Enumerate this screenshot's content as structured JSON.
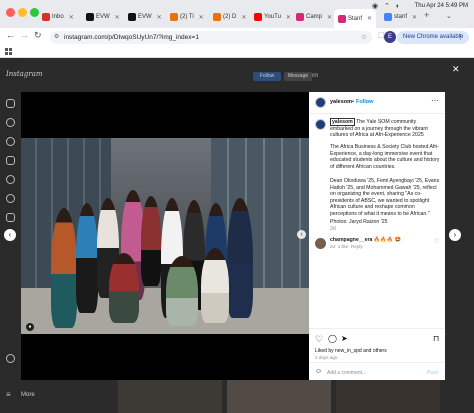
{
  "tabs": [
    {
      "label": "Inbo",
      "color": "#d93025"
    },
    {
      "label": "EVW",
      "color": "#111111"
    },
    {
      "label": "EVW",
      "color": "#111111"
    },
    {
      "label": "(2) Ti",
      "color": "#e8710a"
    },
    {
      "label": "(2) D",
      "color": "#e8710a"
    },
    {
      "label": "YouTu",
      "color": "#ff0000"
    },
    {
      "label": "Camp",
      "color": "#d62976"
    },
    {
      "label": "Stanf",
      "color": "#d62976"
    },
    {
      "label": "stanf",
      "color": "#4285f4"
    }
  ],
  "system": {
    "time": "Thu Apr 24 5:49 PM"
  },
  "address": {
    "url": "instagram.com/p/DIwqoSUyUn7/?img_index=1"
  },
  "chrome_update": {
    "label": "New Chrome available"
  },
  "profile_initial": "E",
  "instagram": {
    "logo": "Instagram",
    "more_label": "More",
    "bg_profile": "yalesom",
    "bg_follow": "Follow",
    "bg_message": "Message"
  },
  "post": {
    "username": "yalesom",
    "follow_label": "Follow",
    "caption_user": "yalesom",
    "caption_1": "The Yale SOM community embarked on a journey through the vibrant cultures of Africa at Afri-Experience 2025",
    "caption_2": "The Africa Business & Society Club hosted Afri-Experience, a day-long immersive event that educated students about the culture and history of different African countries.",
    "caption_3": "Dean Okoduwa '25, Femi Ayengbayi '25, Evans Hatloh '25, and Mohammed Gawah '25, reflect on organizing the event, sharing \"As co-presidents of ABSC, we wanted to spotlight African culture and reshape common perceptions of what it means to be African.\"",
    "caption_4": "Photos: Jaryd Raizon '25",
    "caption_age": "2d",
    "comment_user": "champagne__era",
    "comment_text": "🔥🔥🔥 🤩",
    "comment_age": "2d",
    "comment_likes": "1 like",
    "comment_reply": "Reply",
    "liked_by": "Liked by new_in_spd and others",
    "post_age": "2 days ago",
    "add_comment_placeholder": "Add a comment...",
    "post_button": "Post"
  }
}
